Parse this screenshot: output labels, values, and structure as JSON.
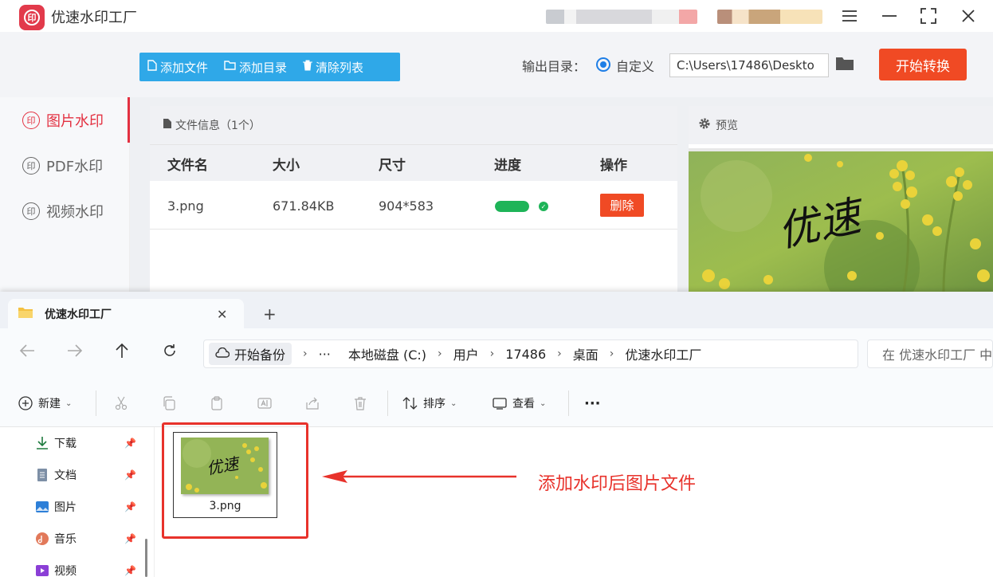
{
  "app": {
    "title": "优速水印工厂",
    "logo_glyph": "印",
    "toolbar": {
      "add_file": "添加文件",
      "add_dir": "添加目录",
      "clear_list": "清除列表"
    },
    "output": {
      "label": "输出目录：",
      "option": "自定义",
      "path": "C:\\Users\\17486\\Deskto"
    },
    "start_button": "开始转换",
    "sidebar": [
      {
        "label": "图片水印",
        "icon": "seal-icon",
        "active": true
      },
      {
        "label": "PDF水印",
        "icon": "seal-icon",
        "active": false
      },
      {
        "label": "视频水印",
        "icon": "seal-icon",
        "active": false
      }
    ],
    "file_panel": {
      "header": "文件信息（1个）",
      "columns": [
        "文件名",
        "大小",
        "尺寸",
        "进度",
        "操作"
      ],
      "rows": [
        {
          "name": "3.png",
          "size": "671.84KB",
          "dim": "904*583",
          "progress": 1.0,
          "action": "删除"
        }
      ]
    },
    "preview": {
      "header": "预览",
      "watermark_text": "优速"
    }
  },
  "explorer": {
    "tab_title": "优速水印工厂",
    "tab_add": "+",
    "breadcrumb": {
      "backup": "开始备份",
      "ellipsis": "···",
      "items": [
        "本地磁盘 (C:)",
        "用户",
        "17486",
        "桌面",
        "优速水印工厂"
      ]
    },
    "search_placeholder": "在 优速水印工厂 中",
    "commands": {
      "new": "新建",
      "sort": "排序",
      "view": "查看",
      "more": "···"
    },
    "nav": [
      {
        "label": "下载",
        "icon": "download-icon"
      },
      {
        "label": "文档",
        "icon": "document-icon"
      },
      {
        "label": "图片",
        "icon": "picture-icon"
      },
      {
        "label": "音乐",
        "icon": "music-icon"
      },
      {
        "label": "视频",
        "icon": "video-icon"
      }
    ],
    "file": {
      "name": "3.png"
    },
    "annotation": "添加水印后图片文件"
  },
  "colors": {
    "brand_red": "#e33141",
    "start_orange": "#f04a24",
    "toolbar_blue": "#2fa8e8",
    "annotation_red": "#e8322b",
    "progress_green": "#1eb458"
  }
}
